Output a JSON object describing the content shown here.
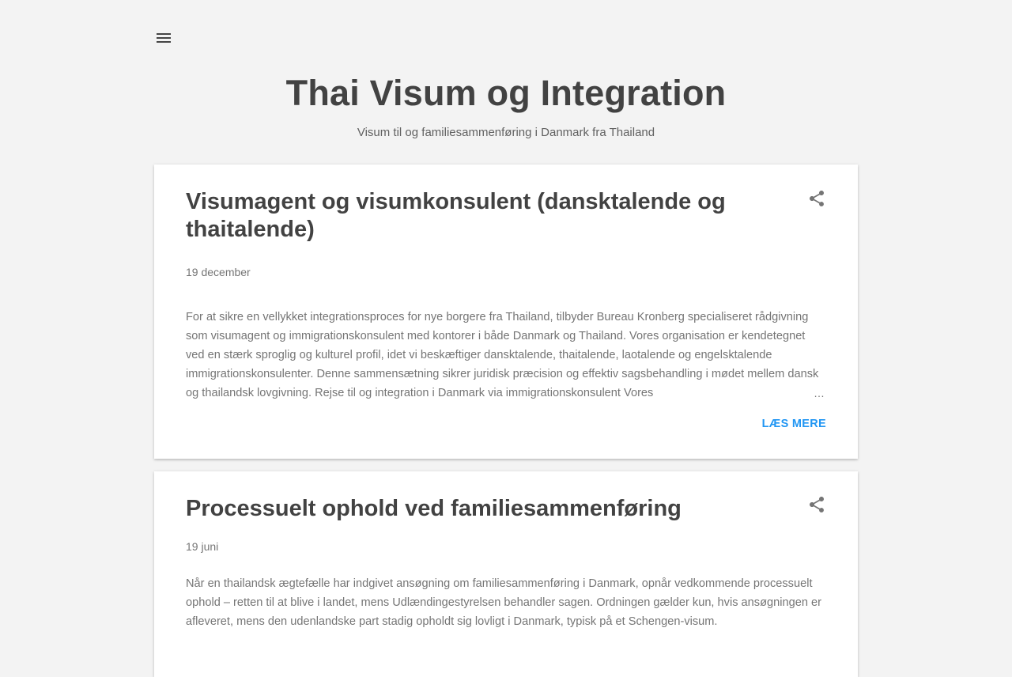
{
  "header": {
    "menu_icon": "hamburger-menu-icon",
    "title": "Thai Visum og Integration",
    "description": "Visum til og familiesammenføring i Danmark fra Thailand"
  },
  "posts": [
    {
      "title": "Visumagent og visumkonsulent (dansktalende og thaitalende)",
      "date": "19 december",
      "snippet": "For at sikre en vellykket integrationsproces for nye borgere fra Thailand, tilbyder Bureau Kronberg specialiseret rådgivning som visumagent og immigrationskonsulent med kontorer i både Danmark og Thailand. Vores organisation er kendetegnet ved en stærk sproglig og kulturel profil, idet vi beskæftiger dansktalende, thaitalende, laotalende og engelsktalende immigrationskonsulenter. Denne sammensætning sikrer juridisk præcision og effektiv sagsbehandling i mødet mellem dansk og thailandsk lovgivning. Rejse til og integration i Danmark via immigrationskonsulent Vores",
      "ellipsis": "…",
      "read_more": "LÆS MERE",
      "share_icon": "share-icon"
    },
    {
      "title": "Processuelt ophold ved familiesammenføring",
      "date": "19 juni",
      "snippet": "Når en thailandsk ægtefælle har indgivet ansøgning om familiesammenføring i Danmark, opnår vedkommende processuelt ophold – retten til at blive i landet, mens Udlændingestyrelsen behandler sagen.  Ordningen gælder kun, hvis ansøgningen er afleveret, mens den udenlandske part stadig opholdt sig lovligt i Danmark, typisk på et Schengen-visum.",
      "share_icon": "share-icon"
    }
  ],
  "colors": {
    "background": "#f3f3f3",
    "card": "#ffffff",
    "title": "#424242",
    "text": "#757575",
    "link": "#2196f3"
  }
}
